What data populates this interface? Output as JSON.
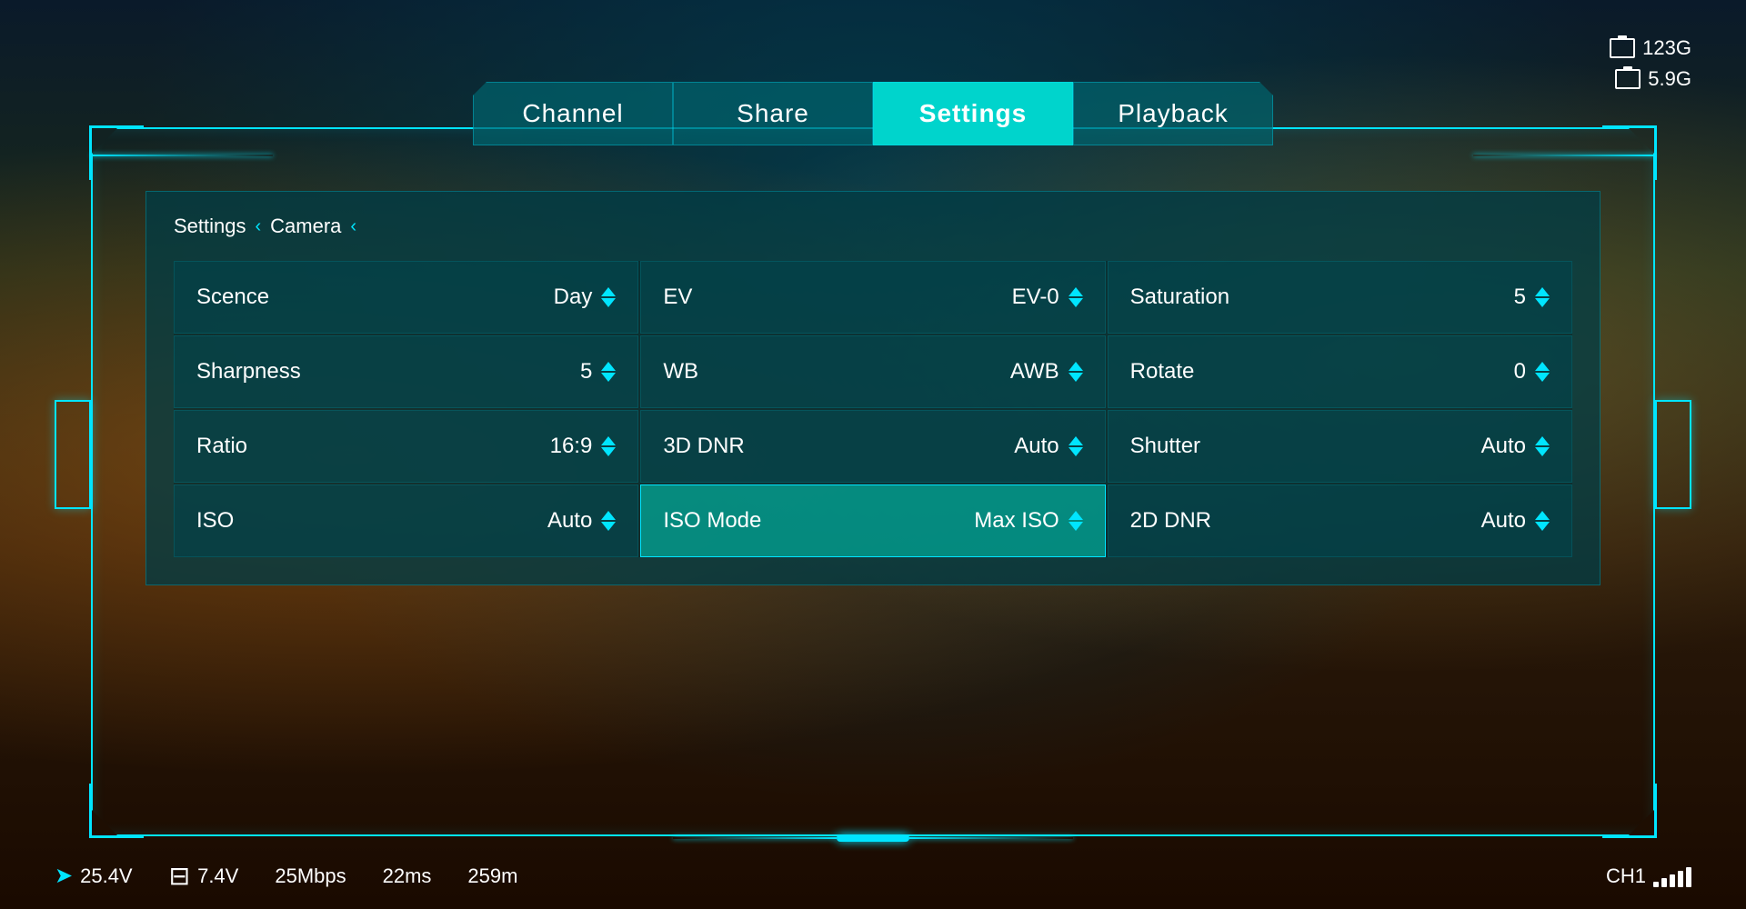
{
  "background": "#0a1a2a",
  "nav": {
    "tabs": [
      {
        "id": "channel",
        "label": "Channel",
        "active": false
      },
      {
        "id": "share",
        "label": "Share",
        "active": false
      },
      {
        "id": "settings",
        "label": "Settings",
        "active": true
      },
      {
        "id": "playback",
        "label": "Playback",
        "active": false
      }
    ]
  },
  "status": {
    "storage1_label": "123G",
    "storage2_label": "5.9G"
  },
  "breadcrumb": {
    "item1": "Settings",
    "item2": "Camera",
    "chevron": "‹"
  },
  "settings": {
    "rows": [
      [
        {
          "label": "Scence",
          "value": "Day",
          "highlighted": false
        },
        {
          "label": "EV",
          "value": "EV-0",
          "highlighted": false
        },
        {
          "label": "Saturation",
          "value": "5",
          "highlighted": false
        }
      ],
      [
        {
          "label": "Sharpness",
          "value": "5",
          "highlighted": false
        },
        {
          "label": "WB",
          "value": "AWB",
          "highlighted": false
        },
        {
          "label": "Rotate",
          "value": "0",
          "highlighted": false
        }
      ],
      [
        {
          "label": "Ratio",
          "value": "16:9",
          "highlighted": false
        },
        {
          "label": "3D DNR",
          "value": "Auto",
          "highlighted": false
        },
        {
          "label": "Shutter",
          "value": "Auto",
          "highlighted": false
        }
      ],
      [
        {
          "label": "ISO",
          "value": "Auto",
          "highlighted": false
        },
        {
          "label": "ISO Mode",
          "value": "Max ISO",
          "highlighted": true
        },
        {
          "label": "2D DNR",
          "value": "Auto",
          "highlighted": false
        }
      ]
    ]
  },
  "bottom_bar": {
    "voltage1": "25.4V",
    "voltage2": "7.4V",
    "bitrate": "25Mbps",
    "latency": "22ms",
    "distance": "259m",
    "channel": "CH1"
  }
}
